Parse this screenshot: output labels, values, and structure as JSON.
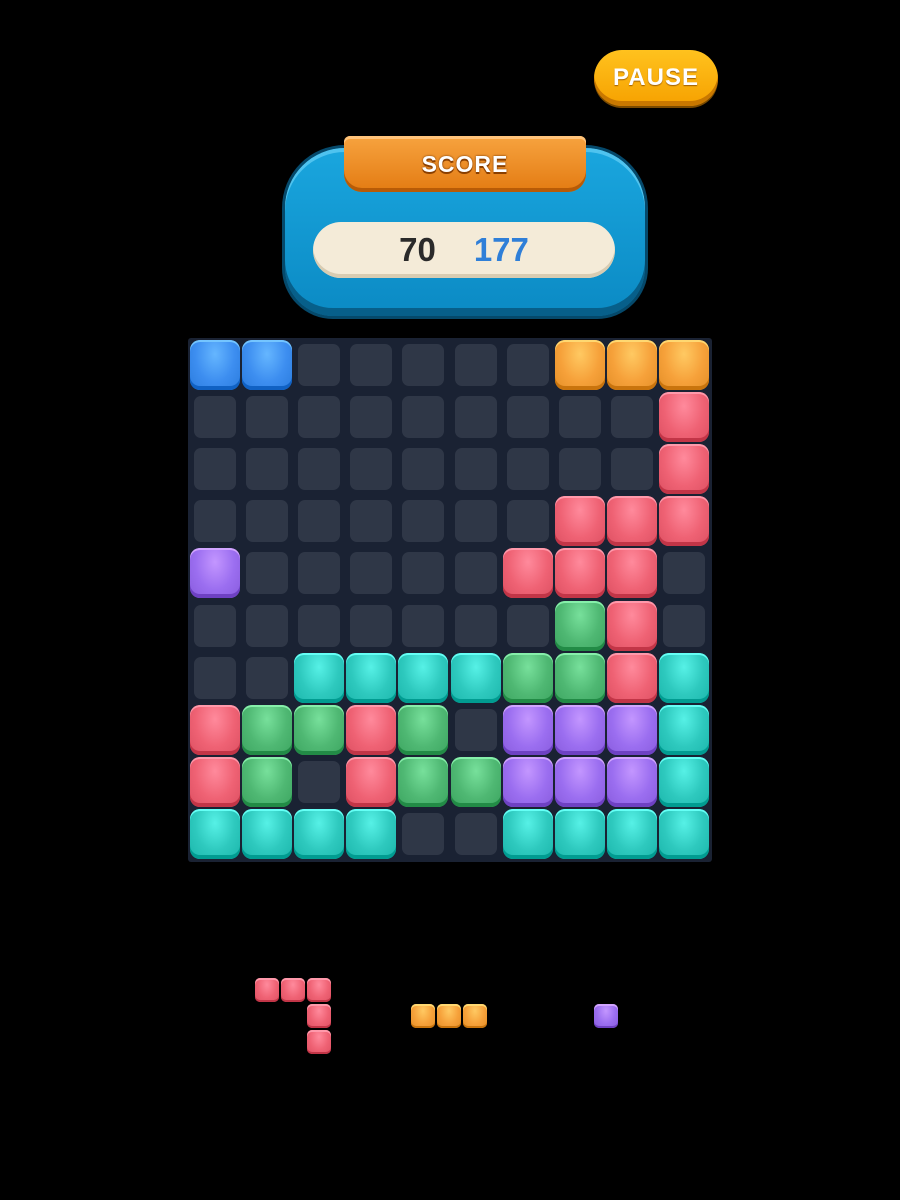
{
  "header": {
    "pause_label": "PAUSE"
  },
  "score": {
    "title": "SCORE",
    "current": "70",
    "best": "177"
  },
  "colors": {
    "blue": "#3d8ef0",
    "orange": "#f6a13a",
    "pink": "#ef6274",
    "purple": "#9b6ef0",
    "green": "#4fb873",
    "teal": "#2ec9be",
    "empty": "#2f3747",
    "board": "#1a2233"
  },
  "board": {
    "rows": [
      [
        "blue",
        "blue",
        null,
        null,
        null,
        null,
        null,
        "orange",
        "orange",
        "orange"
      ],
      [
        null,
        null,
        null,
        null,
        null,
        null,
        null,
        null,
        null,
        "pink"
      ],
      [
        null,
        null,
        null,
        null,
        null,
        null,
        null,
        null,
        null,
        "pink"
      ],
      [
        null,
        null,
        null,
        null,
        null,
        null,
        null,
        "pink",
        "pink",
        "pink"
      ],
      [
        "purple",
        null,
        null,
        null,
        null,
        null,
        "pink",
        "pink",
        "pink",
        null
      ],
      [
        null,
        null,
        null,
        null,
        null,
        null,
        null,
        "green",
        "pink",
        null
      ],
      [
        null,
        null,
        "teal",
        "teal",
        "teal",
        "teal",
        "green",
        "green",
        "pink",
        "teal"
      ],
      [
        "pink",
        "green",
        "green",
        "pink",
        "green",
        null,
        "purple",
        "purple",
        "purple",
        "teal"
      ],
      [
        "pink",
        "green",
        null,
        "pink",
        "green",
        "green",
        "purple",
        "purple",
        "purple",
        "teal"
      ],
      [
        "teal",
        "teal",
        "teal",
        "teal",
        null,
        null,
        "teal",
        "teal",
        "teal",
        "teal"
      ]
    ]
  },
  "tray": {
    "pieces": [
      {
        "name": "pink-corner-piece",
        "color": "pink",
        "cells": [
          [
            0,
            0
          ],
          [
            0,
            1
          ],
          [
            0,
            2
          ],
          [
            1,
            2
          ],
          [
            2,
            2
          ]
        ]
      },
      {
        "name": "orange-bar-piece",
        "color": "orange",
        "cells": [
          [
            0,
            0
          ],
          [
            0,
            1
          ],
          [
            0,
            2
          ]
        ]
      },
      {
        "name": "purple-dot-piece",
        "color": "purple",
        "cells": [
          [
            0,
            0
          ]
        ]
      }
    ]
  }
}
